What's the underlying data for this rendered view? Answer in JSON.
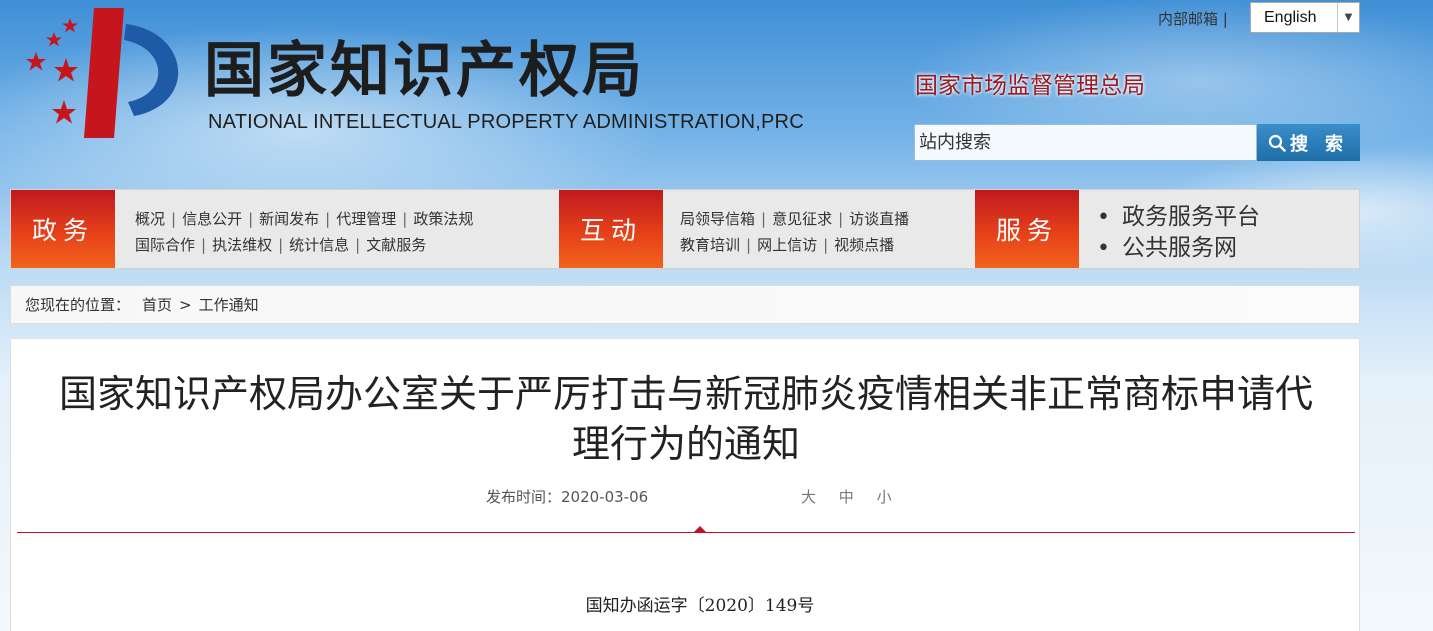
{
  "header": {
    "title_cn": "国家知识产权局",
    "title_en": "NATIONAL INTELLECTUAL PROPERTY ADMINISTRATION,PRC",
    "internal_mail": "内部邮箱 |",
    "language_selected": "English",
    "samr_link": "国家市场监督管理总局",
    "search_placeholder": "站内搜索",
    "search_button": "搜 索"
  },
  "nav": {
    "govt": {
      "label": "政务",
      "row1": [
        "概况",
        "信息公开",
        "新闻发布",
        "代理管理",
        "政策法规"
      ],
      "row2": [
        "国际合作",
        "执法维权",
        "统计信息",
        "文献服务"
      ]
    },
    "interact": {
      "label": "互动",
      "row1": [
        "局领导信箱",
        "意见征求",
        "访谈直播"
      ],
      "row2": [
        "教育培训",
        "网上信访",
        "视频点播"
      ]
    },
    "service": {
      "label": "服务",
      "items": [
        "政务服务平台",
        "公共服务网"
      ]
    }
  },
  "breadcrumb": {
    "prefix": "您现在的位置：",
    "home": "首页",
    "separator": ">",
    "current": "工作通知"
  },
  "article": {
    "title": "国家知识产权局办公室关于严厉打击与新冠肺炎疫情相关非正常商标申请代理行为的通知",
    "publish_time": "发布时间：2020-03-06",
    "font_sizes": [
      "大",
      "中",
      "小"
    ],
    "doc_number": "国知办函运字〔2020〕149号"
  },
  "colors": {
    "nav_accent": "#e8441a",
    "divider": "#c8102e",
    "samr_link": "#9b1b20",
    "search_button": "#1f6ea8"
  }
}
